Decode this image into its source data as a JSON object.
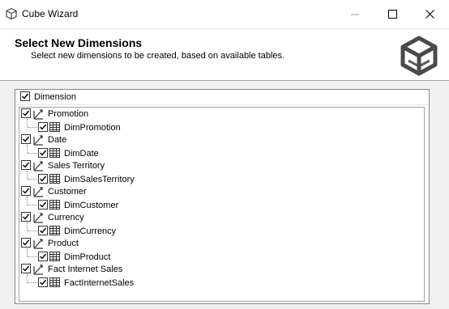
{
  "window": {
    "title": "Cube Wizard",
    "icons": {
      "app": "cube-icon",
      "minimize": "minimize-icon",
      "maximize": "maximize-icon",
      "close": "close-icon"
    }
  },
  "header": {
    "title": "Select New Dimensions",
    "subtitle": "Select new dimensions to be created, based on available tables.",
    "logo_icon": "cube-logo-icon"
  },
  "tree": {
    "column_header": "Dimension",
    "items": [
      {
        "dimension": "Promotion",
        "table": "DimPromotion",
        "checked": true
      },
      {
        "dimension": "Date",
        "table": "DimDate",
        "checked": true
      },
      {
        "dimension": "Sales Territory",
        "table": "DimSalesTerritory",
        "checked": true
      },
      {
        "dimension": "Customer",
        "table": "DimCustomer",
        "checked": true
      },
      {
        "dimension": "Currency",
        "table": "DimCurrency",
        "checked": true
      },
      {
        "dimension": "Product",
        "table": "DimProduct",
        "checked": true
      },
      {
        "dimension": "Fact Internet Sales",
        "table": "FactInternetSales",
        "checked": true
      }
    ]
  },
  "colors": {
    "border": "#828790",
    "header_bg": "#ffffff",
    "body_bg": "#f0f0f0"
  }
}
